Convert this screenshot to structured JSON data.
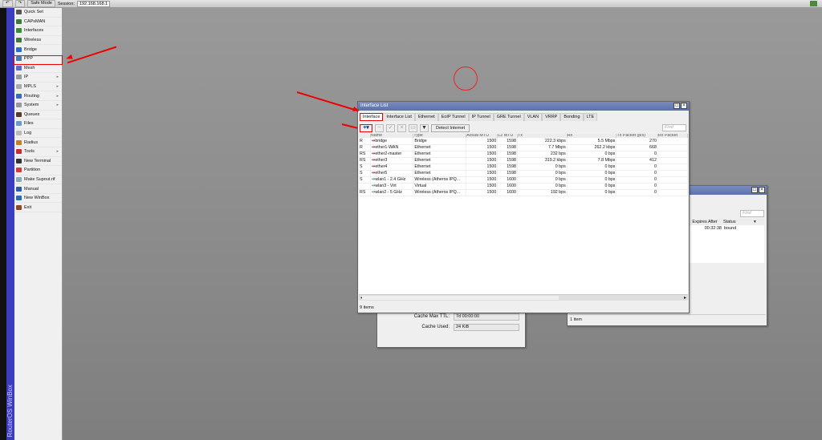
{
  "topbar": {
    "safe_mode": "Safe Mode",
    "session_label": "Session:",
    "session_value": "192.168.168.1"
  },
  "sidebar": {
    "brand": "RouterOS WinBox",
    "items": [
      {
        "label": "Quick Set",
        "color": "#555"
      },
      {
        "label": "CAPsMAN",
        "color": "#3a7a3a"
      },
      {
        "label": "Interfaces",
        "color": "#3a8a3a"
      },
      {
        "label": "Wireless",
        "color": "#3a7a3a"
      },
      {
        "label": "Bridge",
        "color": "#2a6ad0"
      },
      {
        "label": "PPP",
        "color": "#4a7ab0"
      },
      {
        "label": "Mesh",
        "color": "#5a6ad0"
      },
      {
        "label": "IP",
        "color": "#999",
        "sub": true
      },
      {
        "label": "MPLS",
        "color": "#aaa",
        "sub": true
      },
      {
        "label": "Routing",
        "color": "#3a6ac0",
        "sub": true
      },
      {
        "label": "System",
        "color": "#999",
        "sub": true
      },
      {
        "label": "Queues",
        "color": "#5a3a2a"
      },
      {
        "label": "Files",
        "color": "#6a9ad0"
      },
      {
        "label": "Log",
        "color": "#bbb"
      },
      {
        "label": "Radius",
        "color": "#c08030"
      },
      {
        "label": "Tools",
        "color": "#c03030",
        "sub": true
      },
      {
        "label": "New Terminal",
        "color": "#333"
      },
      {
        "label": "Partition",
        "color": "#d03a3a"
      },
      {
        "label": "Make Supout.rif",
        "color": "#8ab"
      },
      {
        "label": "Manual",
        "color": "#2a5ab0"
      },
      {
        "label": "New WinBox",
        "color": "#2a6ab0"
      },
      {
        "label": "Exit",
        "color": "#8a4a2a"
      }
    ]
  },
  "interface_window": {
    "title": "Interface List",
    "tabs": [
      "Interface",
      "Interface List",
      "Ethernet",
      "EoIP Tunnel",
      "IP Tunnel",
      "GRE Tunnel",
      "VLAN",
      "VRRP",
      "Bonding",
      "LTE"
    ],
    "detect_button": "Detect Internet",
    "find_placeholder": "Find",
    "columns": [
      "",
      "Name",
      "Type",
      "Actual MTU",
      "L2 MTU",
      "Tx",
      "Rx",
      "Tx Packet (p/s)",
      "Rx Packet"
    ],
    "rows": [
      [
        "R",
        "bridge",
        "Bridge",
        "1500",
        "1598",
        "222.3 kbps",
        "5.5 Mbps",
        "270",
        ""
      ],
      [
        "R",
        "ether1-WAN",
        "Ethernet",
        "1500",
        "1598",
        "7.7 Mbps",
        "262.2 kbps",
        "668",
        ""
      ],
      [
        "RS",
        "ether2-master",
        "Ethernet",
        "1500",
        "1598",
        "232 bps",
        "0 bps",
        "0",
        ""
      ],
      [
        "RS",
        "ether3",
        "Ethernet",
        "1500",
        "1598",
        "319.2 kbps",
        "7.8 Mbps",
        "412",
        ""
      ],
      [
        "S",
        "ether4",
        "Ethernet",
        "1500",
        "1598",
        "0 bps",
        "0 bps",
        "0",
        ""
      ],
      [
        "S",
        "ether5",
        "Ethernet",
        "1500",
        "1598",
        "0 bps",
        "0 bps",
        "0",
        ""
      ],
      [
        "S",
        "wlan1 - 2.4 GHz",
        "Wireless (Atheros IPQ...",
        "1500",
        "1600",
        "0 bps",
        "0 bps",
        "0",
        ""
      ],
      [
        "",
        "wlan3 - Virt",
        "Virtual",
        "1500",
        "1600",
        "0 bps",
        "0 bps",
        "0",
        ""
      ],
      [
        "RS",
        "wlan2 - 5 GHz",
        "Wireless (Atheros IPQ...",
        "1500",
        "1600",
        "192 bps",
        "0 bps",
        "0",
        ""
      ]
    ],
    "status": "9 items"
  },
  "dns_window": {
    "cache_ttl_label": "Cache Max TTL:",
    "cache_ttl": "7d 00:00:00",
    "cache_used_label": "Cache Used:",
    "cache_used": "24 KiB"
  },
  "dhcp_window": {
    "find_placeholder": "Find",
    "columns": [
      "Expires After",
      "Status"
    ],
    "row": [
      "00:32:38",
      "bound"
    ],
    "status": "1 item"
  },
  "annotation_color": "#e00000"
}
